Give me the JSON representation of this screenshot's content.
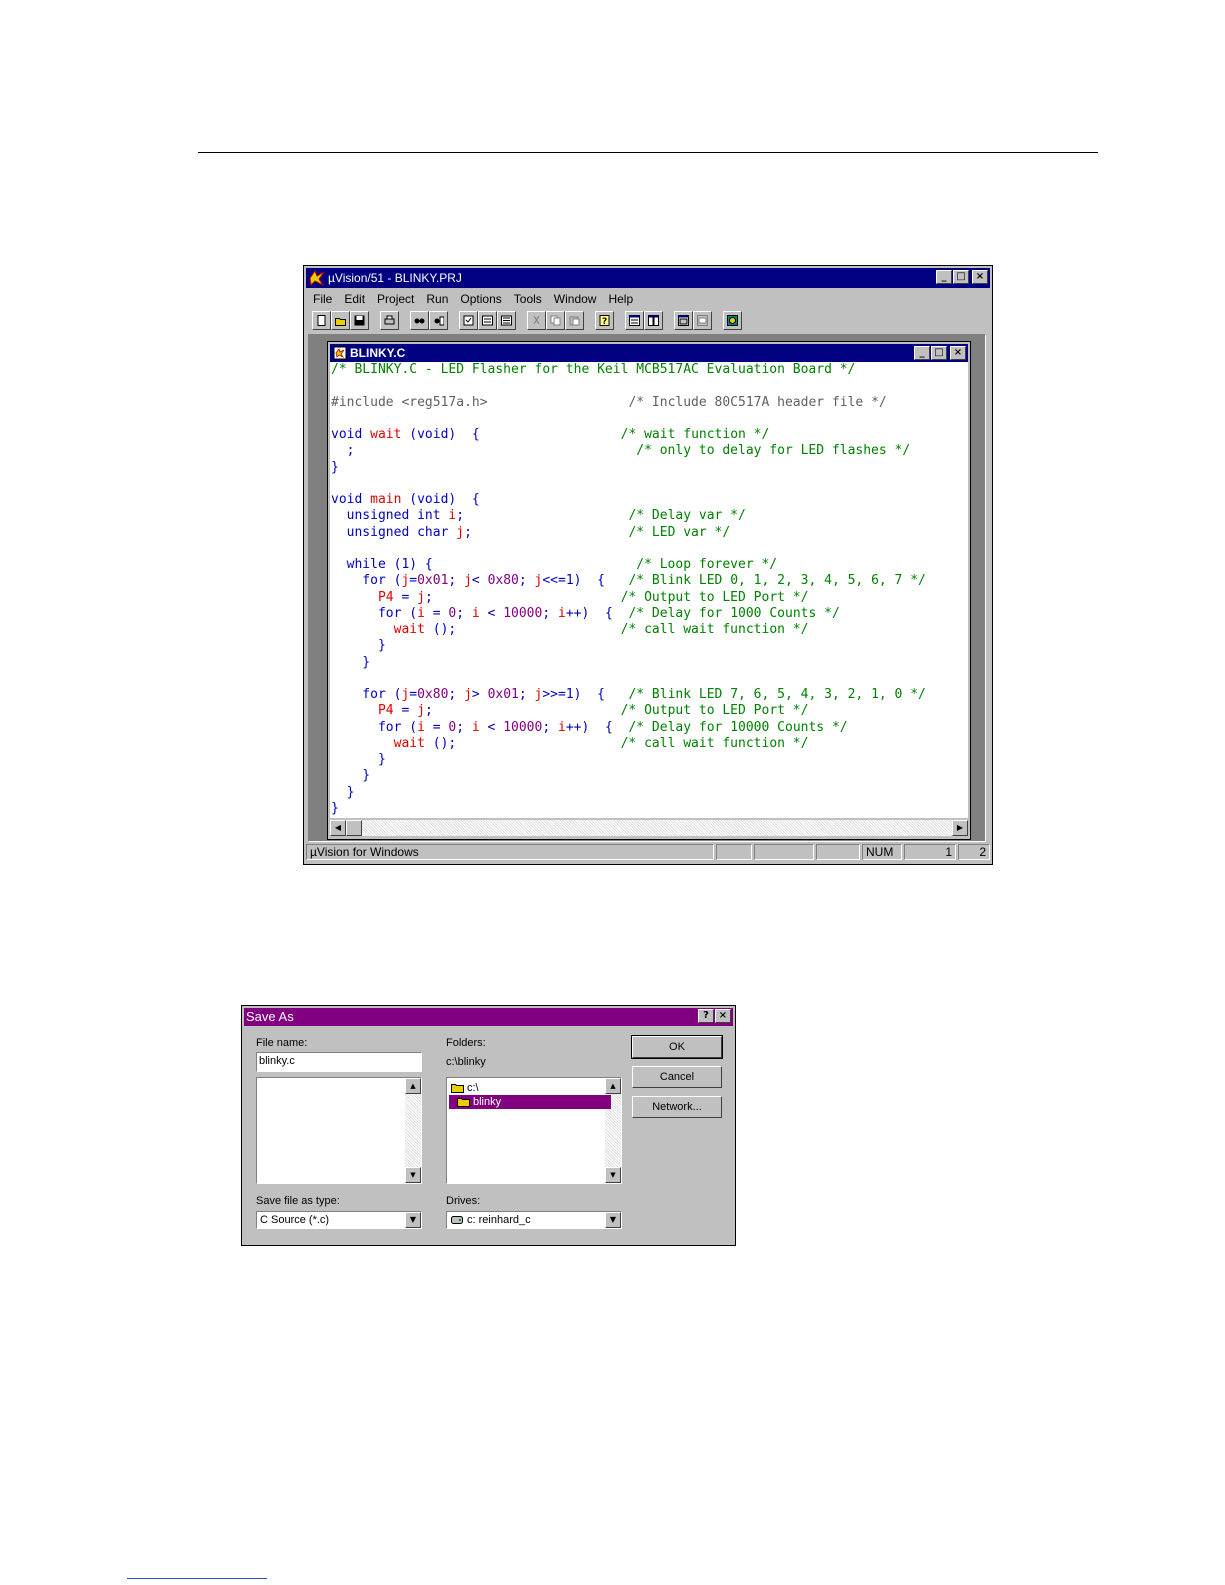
{
  "main_window": {
    "title": "µVision/51 - BLINKY.PRJ",
    "menu": [
      {
        "name": "menu-file",
        "label": "File"
      },
      {
        "name": "menu-edit",
        "label": "Edit"
      },
      {
        "name": "menu-project",
        "label": "Project"
      },
      {
        "name": "menu-run",
        "label": "Run"
      },
      {
        "name": "menu-options",
        "label": "Options"
      },
      {
        "name": "menu-tools",
        "label": "Tools"
      },
      {
        "name": "menu-window",
        "label": "Window"
      },
      {
        "name": "menu-help",
        "label": "Help"
      }
    ],
    "toolbar_groups": [
      [
        "new-file-icon",
        "open-file-icon",
        "save-file-icon"
      ],
      [
        "print-icon"
      ],
      [
        "find-icon",
        "replace-icon"
      ],
      [
        "compile-icon",
        "build-icon",
        "rebuild-icon"
      ],
      [
        "cut-icon",
        "copy-icon",
        "paste-icon"
      ],
      [
        "help-icon"
      ],
      [
        "tile-icon",
        "cascade-icon"
      ],
      [
        "project-icon",
        "options-icon"
      ],
      [
        "debug-icon"
      ]
    ],
    "status": {
      "text": "µVision for Windows",
      "num": "NUM",
      "line": "1",
      "col": "2"
    }
  },
  "editor": {
    "title": "BLINKY.C",
    "lines": [
      [
        [
          "cm",
          "/* BLINKY.C - LED Flasher for the Keil MCB517AC Evaluation Board */"
        ]
      ],
      [],
      [
        [
          "pp",
          "#include <reg517a.h>"
        ],
        [
          "pl",
          "                  "
        ],
        [
          "pp",
          "/* Include 80C517A header file */"
        ]
      ],
      [],
      [
        [
          "kw",
          "void "
        ],
        [
          "id",
          "wait"
        ],
        [
          "kw",
          " (void)  {"
        ],
        [
          "pl",
          "                  "
        ],
        [
          "cm",
          "/* wait function */"
        ]
      ],
      [
        [
          "pl",
          "  ;"
        ],
        [
          "pl",
          "                                    "
        ],
        [
          "cm",
          "/* only to delay for LED flashes */"
        ]
      ],
      [
        [
          "kw",
          "}"
        ]
      ],
      [],
      [
        [
          "kw",
          "void "
        ],
        [
          "id",
          "main"
        ],
        [
          "kw",
          " (void)  {"
        ]
      ],
      [
        [
          "kw",
          "  unsigned int "
        ],
        [
          "id",
          "i"
        ],
        [
          "pl",
          ";"
        ],
        [
          "pl",
          "                     "
        ],
        [
          "cm",
          "/* Delay var */"
        ]
      ],
      [
        [
          "kw",
          "  unsigned char "
        ],
        [
          "id",
          "j"
        ],
        [
          "pl",
          ";"
        ],
        [
          "pl",
          "                    "
        ],
        [
          "cm",
          "/* LED var */"
        ]
      ],
      [],
      [
        [
          "kw",
          "  while (1) {"
        ],
        [
          "pl",
          "                          "
        ],
        [
          "cm",
          "/* Loop forever */"
        ]
      ],
      [
        [
          "kw",
          "    for ("
        ],
        [
          "id",
          "j"
        ],
        [
          "pl",
          "="
        ],
        [
          "nm",
          "0x01"
        ],
        [
          "pl",
          "; "
        ],
        [
          "id",
          "j"
        ],
        [
          "pl",
          "< "
        ],
        [
          "nm",
          "0x80"
        ],
        [
          "pl",
          "; "
        ],
        [
          "id",
          "j"
        ],
        [
          "pl",
          "<<=1)  {   "
        ],
        [
          "cm",
          "/* Blink LED 0, 1, 2, 3, 4, 5, 6, 7 */"
        ]
      ],
      [
        [
          "id",
          "      P4"
        ],
        [
          "pl",
          " = "
        ],
        [
          "id",
          "j"
        ],
        [
          "pl",
          ";"
        ],
        [
          "pl",
          "                        "
        ],
        [
          "cm",
          "/* Output to LED Port */"
        ]
      ],
      [
        [
          "kw",
          "      for ("
        ],
        [
          "id",
          "i"
        ],
        [
          "pl",
          " = "
        ],
        [
          "nm",
          "0"
        ],
        [
          "pl",
          "; "
        ],
        [
          "id",
          "i"
        ],
        [
          "pl",
          " < "
        ],
        [
          "nm",
          "10000"
        ],
        [
          "pl",
          "; "
        ],
        [
          "id",
          "i"
        ],
        [
          "pl",
          "++)  {  "
        ],
        [
          "cm",
          "/* Delay for 1000 Counts */"
        ]
      ],
      [
        [
          "id",
          "        wait"
        ],
        [
          "pl",
          " ();"
        ],
        [
          "pl",
          "                     "
        ],
        [
          "cm",
          "/* call wait function */"
        ]
      ],
      [
        [
          "kw",
          "      }"
        ]
      ],
      [
        [
          "kw",
          "    }"
        ]
      ],
      [],
      [
        [
          "kw",
          "    for ("
        ],
        [
          "id",
          "j"
        ],
        [
          "pl",
          "="
        ],
        [
          "nm",
          "0x80"
        ],
        [
          "pl",
          "; "
        ],
        [
          "id",
          "j"
        ],
        [
          "pl",
          "> "
        ],
        [
          "nm",
          "0x01"
        ],
        [
          "pl",
          "; "
        ],
        [
          "id",
          "j"
        ],
        [
          "pl",
          ">>=1)  {   "
        ],
        [
          "cm",
          "/* Blink LED 7, 6, 5, 4, 3, 2, 1, 0 */"
        ]
      ],
      [
        [
          "id",
          "      P4"
        ],
        [
          "pl",
          " = "
        ],
        [
          "id",
          "j"
        ],
        [
          "pl",
          ";"
        ],
        [
          "pl",
          "                        "
        ],
        [
          "cm",
          "/* Output to LED Port */"
        ]
      ],
      [
        [
          "kw",
          "      for ("
        ],
        [
          "id",
          "i"
        ],
        [
          "pl",
          " = "
        ],
        [
          "nm",
          "0"
        ],
        [
          "pl",
          "; "
        ],
        [
          "id",
          "i"
        ],
        [
          "pl",
          " < "
        ],
        [
          "nm",
          "10000"
        ],
        [
          "pl",
          "; "
        ],
        [
          "id",
          "i"
        ],
        [
          "pl",
          "++)  {  "
        ],
        [
          "cm",
          "/* Delay for 10000 Counts */"
        ]
      ],
      [
        [
          "id",
          "        wait"
        ],
        [
          "pl",
          " ();"
        ],
        [
          "pl",
          "                     "
        ],
        [
          "cm",
          "/* call wait function */"
        ]
      ],
      [
        [
          "kw",
          "      }"
        ]
      ],
      [
        [
          "kw",
          "    }"
        ]
      ],
      [
        [
          "kw",
          "  }"
        ]
      ],
      [
        [
          "kw",
          "}"
        ]
      ]
    ]
  },
  "save_dialog": {
    "title": "Save As",
    "help_button": "?",
    "close_button": "×",
    "file_name_label": "File name:",
    "file_name_value": "blinky.c",
    "folders_label": "Folders:",
    "current_folder": "c:\\blinky",
    "folders": [
      {
        "name": "c:\\",
        "selected": false
      },
      {
        "name": "blinky",
        "selected": true
      }
    ],
    "save_type_label": "Save file as type:",
    "save_type_value": "C Source (*.c)",
    "drives_label": "Drives:",
    "drive_value": "c: reinhard_c",
    "ok": "OK",
    "cancel": "Cancel",
    "network": "Network..."
  }
}
